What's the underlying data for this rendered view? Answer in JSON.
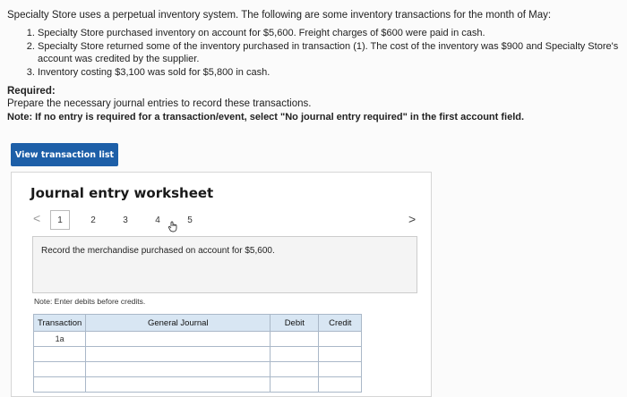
{
  "intro": "Specialty Store uses a perpetual inventory system. The following are some inventory transactions for the month of May:",
  "steps": [
    "Specialty Store purchased inventory on account for $5,600. Freight charges of $600 were paid in cash.",
    "Specialty Store returned some of the inventory purchased in transaction (1). The cost of the inventory was $900 and Specialty Store's account was credited by the supplier.",
    "Inventory costing $3,100 was sold for $5,800 in cash."
  ],
  "required": {
    "heading": "Required:",
    "text": "Prepare the necessary journal entries to record these transactions.",
    "note": "Note: If no entry is required for a transaction/event, select \"No journal entry required\" in the first account field."
  },
  "view_button": "View transaction list",
  "worksheet": {
    "title": "Journal entry worksheet",
    "prev": "<",
    "next": ">",
    "pages": [
      "1",
      "2",
      "3",
      "4",
      "5"
    ],
    "active_page": "1",
    "prompt": "Record the merchandise purchased on account for $5,600.",
    "note": "Note: Enter debits before credits."
  },
  "journal": {
    "headers": [
      "Transaction",
      "General Journal",
      "Debit",
      "Credit"
    ],
    "rows": [
      {
        "transaction": "1a"
      },
      {
        "transaction": ""
      },
      {
        "transaction": ""
      },
      {
        "transaction": ""
      }
    ]
  },
  "colors": {
    "accent": "#1d5fa8",
    "header_bg": "#d8e6f3"
  }
}
